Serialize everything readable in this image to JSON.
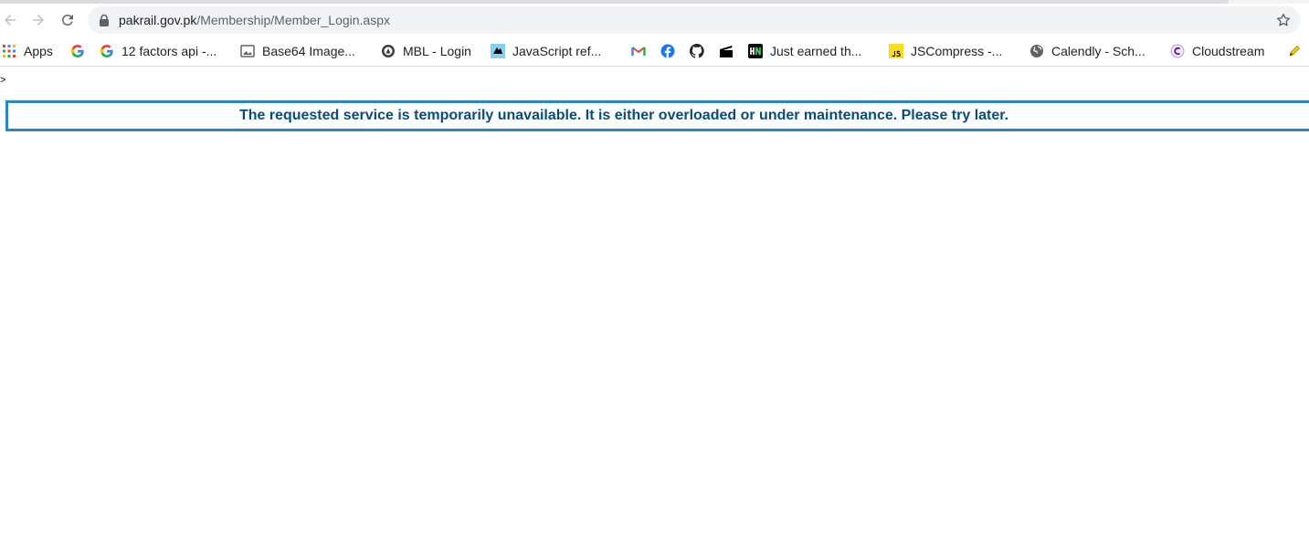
{
  "browser": {
    "url_host": "pakrail.gov.pk",
    "url_path": "/Membership/Member_Login.aspx"
  },
  "bookmarks": [
    {
      "label": "Apps",
      "icon": "apps-grid-icon"
    },
    {
      "label": "",
      "icon": "google-icon"
    },
    {
      "label": "12 factors api -...",
      "icon": "google-icon"
    },
    {
      "label": "Base64 Image...",
      "icon": "image-icon"
    },
    {
      "label": "MBL - Login",
      "icon": "mbl-icon"
    },
    {
      "label": "JavaScript ref...",
      "icon": "mdn-icon"
    },
    {
      "label": "",
      "icon": "gmail-icon"
    },
    {
      "label": "",
      "icon": "facebook-icon"
    },
    {
      "label": "",
      "icon": "github-icon"
    },
    {
      "label": "",
      "icon": "clapperboard-icon"
    },
    {
      "label": "Just earned th...",
      "icon": "hn-icon"
    },
    {
      "label": "JSCompress -...",
      "icon": "js-icon"
    },
    {
      "label": "Calendly - Sch...",
      "icon": "globe-icon"
    },
    {
      "label": "Cloudstream",
      "icon": "cloudstream-icon"
    },
    {
      "label": "",
      "icon": "pencil-icon"
    }
  ],
  "page": {
    "stray_char": ">",
    "error_message": "The requested service is temporarily unavailable. It is either overloaded or under maintenance. Please try later."
  },
  "colors": {
    "error_border": "#2a86bf",
    "error_text": "#084c7e"
  }
}
